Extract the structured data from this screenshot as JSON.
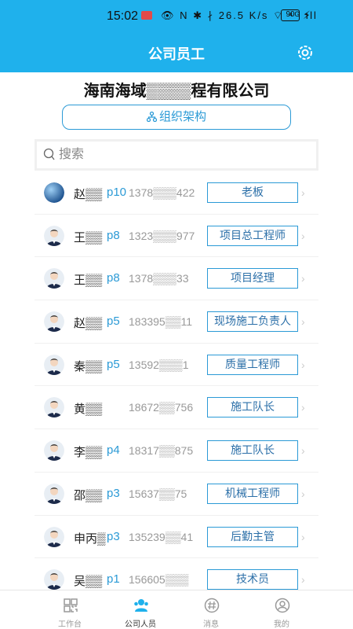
{
  "status_bar": {
    "time": "15:02",
    "icons_text": "👁 N ✱ ∤ 26.5 K/s ⌔ ⁴ᴳ ıll",
    "battery": "90"
  },
  "header": {
    "title": "公司员工"
  },
  "company": {
    "name": "海南海域▒▒▒▒程有限公司"
  },
  "org_button": {
    "label": "组织架构"
  },
  "search": {
    "placeholder": "搜索"
  },
  "employees": [
    {
      "name": "赵▒▒",
      "level": "p10",
      "phone": "1378▒▒▒422",
      "role": "老板",
      "avatar": "globe"
    },
    {
      "name": "王▒▒",
      "level": "p8",
      "phone": "1323▒▒▒977",
      "role": "项目总工程师",
      "avatar": "person"
    },
    {
      "name": "王▒▒",
      "level": "p8",
      "phone": "1378▒▒▒33",
      "role": "项目经理",
      "avatar": "person"
    },
    {
      "name": "赵▒▒",
      "level": "p5",
      "phone": "183395▒▒11",
      "role": "现场施工负责人",
      "avatar": "person"
    },
    {
      "name": "秦▒▒",
      "level": "p5",
      "phone": "13592▒▒▒1",
      "role": "质量工程师",
      "avatar": "person"
    },
    {
      "name": "黄▒▒",
      "level": "",
      "phone": "18672▒▒756",
      "role": "施工队长",
      "avatar": "person"
    },
    {
      "name": "李▒▒",
      "level": "p4",
      "phone": "18317▒▒875",
      "role": "施工队长",
      "avatar": "person"
    },
    {
      "name": "邵▒▒",
      "level": "p3",
      "phone": "15637▒▒75",
      "role": "机械工程师",
      "avatar": "person"
    },
    {
      "name": "申丙▒",
      "level": "p3",
      "phone": "135239▒▒41",
      "role": "后勤主管",
      "avatar": "person"
    },
    {
      "name": "吴▒▒",
      "level": "p1",
      "phone": "156605▒▒▒",
      "role": "技术员",
      "avatar": "person"
    }
  ],
  "tabs": [
    {
      "label": "工作台",
      "icon": "grid-icon",
      "active": false
    },
    {
      "label": "公司人员",
      "icon": "people-icon",
      "active": true
    },
    {
      "label": "消息",
      "icon": "hash-message-icon",
      "active": false
    },
    {
      "label": "我的",
      "icon": "profile-icon",
      "active": false
    }
  ],
  "colors": {
    "primary": "#1fb1ec",
    "accent": "#2b9ad6",
    "active_tab": "#1fb1ec"
  }
}
